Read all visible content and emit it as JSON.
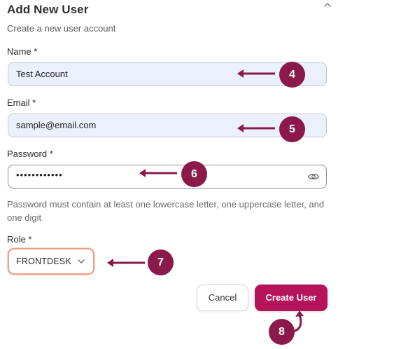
{
  "dialog": {
    "title": "Add New User",
    "subtitle": "Create a new user account"
  },
  "form": {
    "name_label": "Name *",
    "name_value": "Test Account",
    "email_label": "Email *",
    "email_value": "sample@email.com",
    "password_label": "Password *",
    "password_value": "••••••••••••",
    "password_helper": "Password must contain at least one lowercase letter, one uppercase letter, and one digit",
    "role_label": "Role *",
    "role_value": "FRONTDESK"
  },
  "actions": {
    "cancel_label": "Cancel",
    "create_label": "Create User"
  },
  "annotations": {
    "step4": "4",
    "step5": "5",
    "step6": "6",
    "step7": "7",
    "step8": "8"
  },
  "icons": {
    "collapse": "chevron-up-icon",
    "password_toggle": "eye-icon",
    "role_dropdown": "chevron-down-icon"
  },
  "colors": {
    "primary": "#b5135a",
    "annotation": "#8b1a4a",
    "field_fill": "#eaf0fc",
    "role_focus_border": "#e9a28a"
  }
}
